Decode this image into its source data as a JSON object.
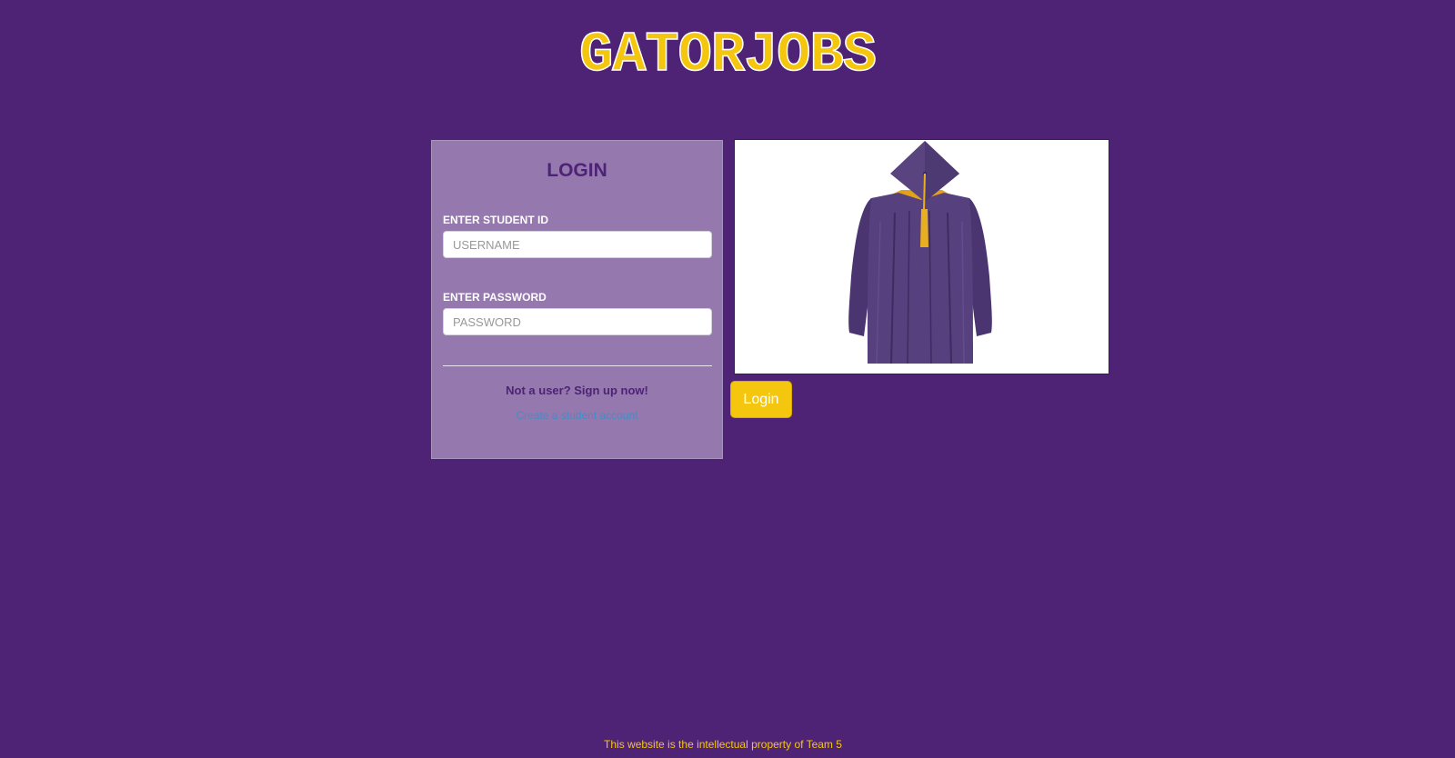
{
  "brand": {
    "logo_text": "GATORJOBS"
  },
  "login_panel": {
    "title": "LOGIN",
    "student_id_label": "ENTER STUDENT ID",
    "username_placeholder": "USERNAME",
    "username_value": "",
    "password_label": "ENTER PASSWORD",
    "password_placeholder": "PASSWORD",
    "password_value": "",
    "signup_prompt": "Not a user? Sign up now!",
    "signup_link": "Create a student account"
  },
  "login_button": {
    "label": "Login"
  },
  "footer": {
    "text": "This website is the intellectual property of Team 5"
  },
  "colors": {
    "background": "#4e2376",
    "panel": "#9478ae",
    "accent_gold": "#f4c70e",
    "link_blue": "#3f8fc9"
  },
  "icons": {
    "hero_image": "graduation-gown-and-cap"
  }
}
